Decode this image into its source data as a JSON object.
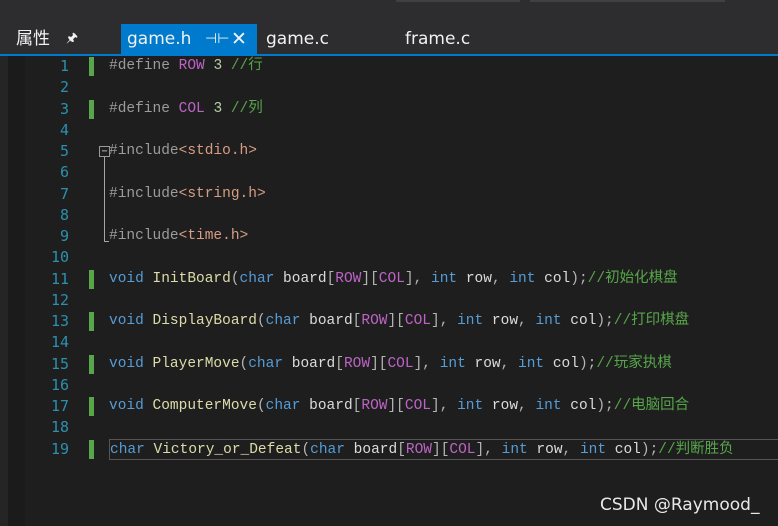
{
  "panel": {
    "title": "属性",
    "pin_glyph": "🖈"
  },
  "tabs": [
    {
      "label": "game.h",
      "active": true,
      "pin_glyph": "⊣⊢",
      "close_glyph": "✕"
    },
    {
      "label": "game.c",
      "active": false
    },
    {
      "label": "frame.c",
      "active": false
    }
  ],
  "lines": [
    {
      "n": "1",
      "t": [
        [
          "pp",
          "#define "
        ],
        [
          "macro",
          "ROW"
        ],
        [
          "txt",
          " "
        ],
        [
          "num",
          "3"
        ],
        [
          "txt",
          " "
        ],
        [
          "cmt",
          "//行"
        ]
      ]
    },
    {
      "n": "2",
      "t": []
    },
    {
      "n": "3",
      "t": [
        [
          "pp",
          "#define "
        ],
        [
          "macro",
          "COL"
        ],
        [
          "txt",
          " "
        ],
        [
          "num",
          "3"
        ],
        [
          "txt",
          " "
        ],
        [
          "cmt",
          "//列"
        ]
      ]
    },
    {
      "n": "4",
      "t": []
    },
    {
      "n": "5",
      "t": [
        [
          "pp",
          "#include"
        ],
        [
          "str",
          "<stdio.h>"
        ]
      ]
    },
    {
      "n": "6",
      "t": []
    },
    {
      "n": "7",
      "t": [
        [
          "pp",
          "#include"
        ],
        [
          "str",
          "<string.h>"
        ]
      ]
    },
    {
      "n": "8",
      "t": []
    },
    {
      "n": "9",
      "t": [
        [
          "pp",
          "#include"
        ],
        [
          "str",
          "<time.h>"
        ]
      ]
    },
    {
      "n": "10",
      "t": []
    },
    {
      "n": "11",
      "t": [
        [
          "kw",
          "void"
        ],
        [
          "txt",
          " "
        ],
        [
          "fn",
          "InitBoard"
        ],
        [
          "pun",
          "("
        ],
        [
          "kw",
          "char"
        ],
        [
          "txt",
          " board"
        ],
        [
          "pun",
          "["
        ],
        [
          "macro",
          "ROW"
        ],
        [
          "pun",
          "]["
        ],
        [
          "macro",
          "COL"
        ],
        [
          "pun",
          "], "
        ],
        [
          "kw",
          "int"
        ],
        [
          "txt",
          " row"
        ],
        [
          "pun",
          ", "
        ],
        [
          "kw",
          "int"
        ],
        [
          "txt",
          " col"
        ],
        [
          "pun",
          ");"
        ],
        [
          "cmt",
          "//初始化棋盘"
        ]
      ]
    },
    {
      "n": "12",
      "t": []
    },
    {
      "n": "13",
      "t": [
        [
          "kw",
          "void"
        ],
        [
          "txt",
          " "
        ],
        [
          "fn",
          "DisplayBoard"
        ],
        [
          "pun",
          "("
        ],
        [
          "kw",
          "char"
        ],
        [
          "txt",
          " board"
        ],
        [
          "pun",
          "["
        ],
        [
          "macro",
          "ROW"
        ],
        [
          "pun",
          "]["
        ],
        [
          "macro",
          "COL"
        ],
        [
          "pun",
          "], "
        ],
        [
          "kw",
          "int"
        ],
        [
          "txt",
          " row"
        ],
        [
          "pun",
          ", "
        ],
        [
          "kw",
          "int"
        ],
        [
          "txt",
          " col"
        ],
        [
          "pun",
          ");"
        ],
        [
          "cmt",
          "//打印棋盘"
        ]
      ]
    },
    {
      "n": "14",
      "t": []
    },
    {
      "n": "15",
      "t": [
        [
          "kw",
          "void"
        ],
        [
          "txt",
          " "
        ],
        [
          "fn",
          "PlayerMove"
        ],
        [
          "pun",
          "("
        ],
        [
          "kw",
          "char"
        ],
        [
          "txt",
          " board"
        ],
        [
          "pun",
          "["
        ],
        [
          "macro",
          "ROW"
        ],
        [
          "pun",
          "]["
        ],
        [
          "macro",
          "COL"
        ],
        [
          "pun",
          "], "
        ],
        [
          "kw",
          "int"
        ],
        [
          "txt",
          " row"
        ],
        [
          "pun",
          ", "
        ],
        [
          "kw",
          "int"
        ],
        [
          "txt",
          " col"
        ],
        [
          "pun",
          ");"
        ],
        [
          "cmt",
          "//玩家执棋"
        ]
      ]
    },
    {
      "n": "16",
      "t": []
    },
    {
      "n": "17",
      "t": [
        [
          "kw",
          "void"
        ],
        [
          "txt",
          " "
        ],
        [
          "fn",
          "ComputerMove"
        ],
        [
          "pun",
          "("
        ],
        [
          "kw",
          "char"
        ],
        [
          "txt",
          " board"
        ],
        [
          "pun",
          "["
        ],
        [
          "macro",
          "ROW"
        ],
        [
          "pun",
          "]["
        ],
        [
          "macro",
          "COL"
        ],
        [
          "pun",
          "], "
        ],
        [
          "kw",
          "int"
        ],
        [
          "txt",
          " row"
        ],
        [
          "pun",
          ", "
        ],
        [
          "kw",
          "int"
        ],
        [
          "txt",
          " col"
        ],
        [
          "pun",
          ");"
        ],
        [
          "cmt",
          "//电脑回合"
        ]
      ]
    },
    {
      "n": "18",
      "t": []
    },
    {
      "n": "19",
      "t": [
        [
          "kw",
          "char"
        ],
        [
          "txt",
          " "
        ],
        [
          "fn",
          "Victory_or_Defeat"
        ],
        [
          "pun",
          "("
        ],
        [
          "kw",
          "char"
        ],
        [
          "txt",
          " board"
        ],
        [
          "pun",
          "["
        ],
        [
          "macro",
          "ROW"
        ],
        [
          "pun",
          "]["
        ],
        [
          "macro",
          "COL"
        ],
        [
          "pun",
          "], "
        ],
        [
          "kw",
          "int"
        ],
        [
          "txt",
          " row"
        ],
        [
          "pun",
          ", "
        ],
        [
          "kw",
          "int"
        ],
        [
          "txt",
          " col"
        ],
        [
          "pun",
          ");"
        ],
        [
          "cmt",
          "//判断胜负"
        ]
      ]
    }
  ],
  "watermark": "CSDN @Raymood_",
  "colors": {
    "editor_bg": "#1e1e1e",
    "chrome_bg": "#2d2d30",
    "accent": "#007acc",
    "keyword": "#569cd6",
    "function": "#dcdcaa",
    "macro": "#bd63c5",
    "comment": "#57a64a",
    "string": "#d69d85",
    "line_number": "#2b91af"
  }
}
